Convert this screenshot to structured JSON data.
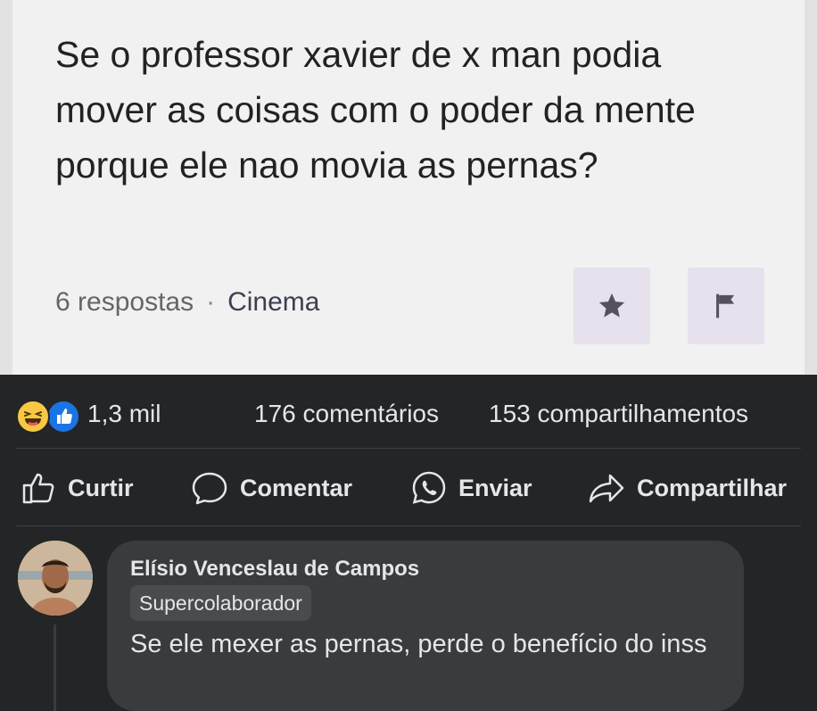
{
  "question": {
    "text": "Se o professor xavier de x man podia mover as coisas com o poder da mente porque ele nao movia as pernas?",
    "answers": "6 respostas",
    "separator": "·",
    "category": "Cinema",
    "icons": [
      "star-icon",
      "flag-icon"
    ]
  },
  "stats": {
    "reaction_icons": [
      "haha-icon",
      "like-icon"
    ],
    "reactions_count": "1,3 mil",
    "comments": "176 comentários",
    "shares": "153 compartilhamentos"
  },
  "actions": {
    "like": "Curtir",
    "comment": "Comentar",
    "send": "Enviar",
    "share": "Compartilhar"
  },
  "comment": {
    "author": "Elísio Venceslau de Campos",
    "badge": "Supercolaborador",
    "text": "Se ele mexer as pernas, perde o benefício do inss"
  },
  "colors": {
    "background": "#242526",
    "card": "#f1f1f1",
    "bubble": "#3a3b3c",
    "text_light": "#e4e6eb",
    "like_blue": "#1b74e4",
    "haha_yellow": "#f7c844"
  }
}
